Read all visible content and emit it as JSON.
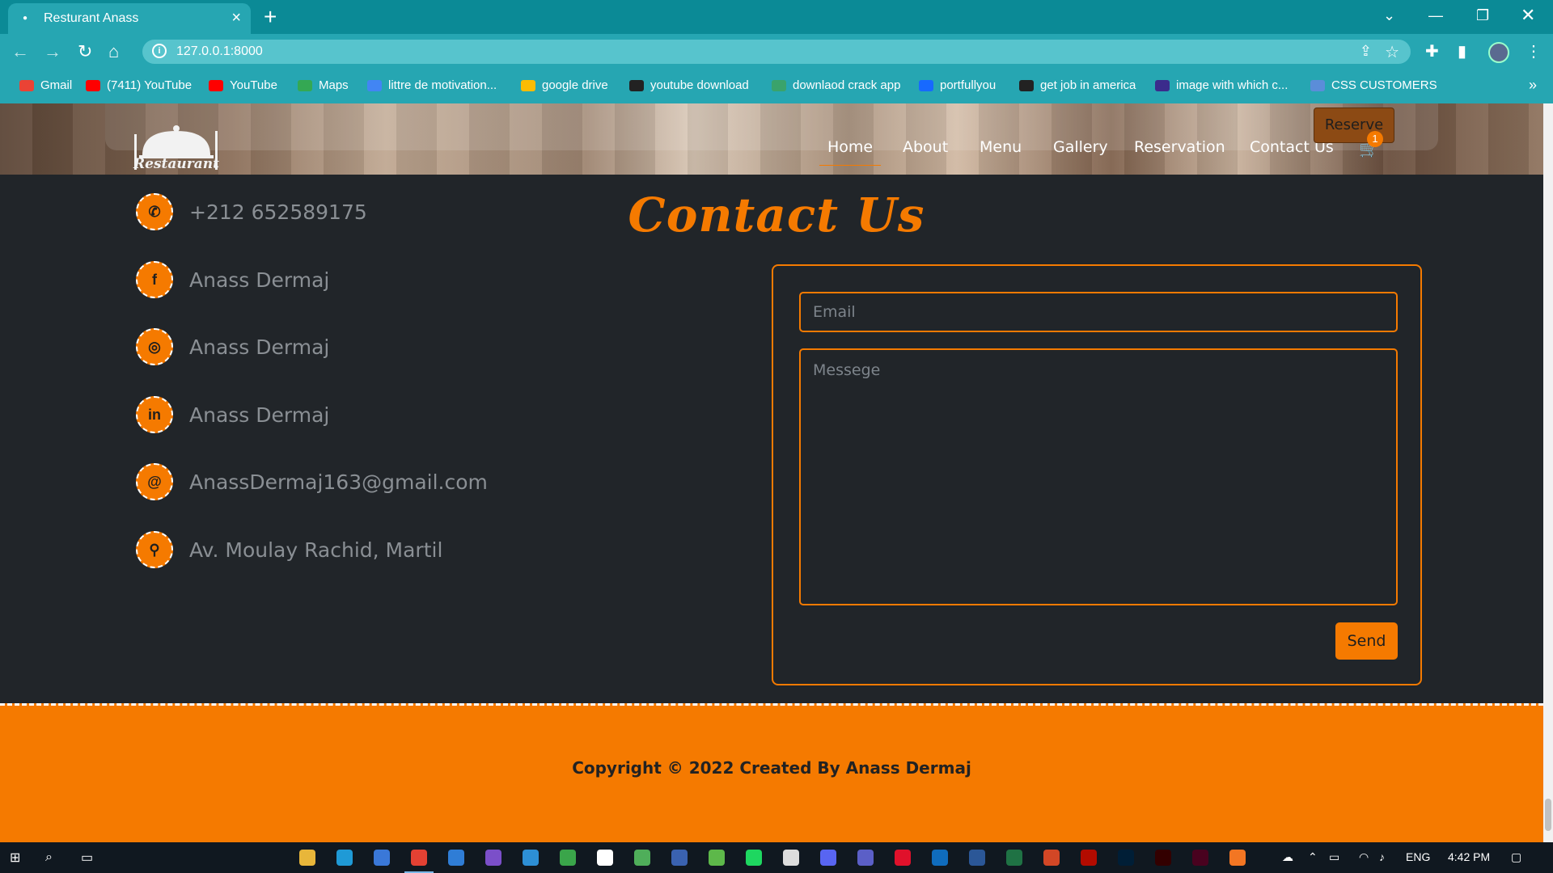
{
  "browser": {
    "tab_title": "Resturant Anass",
    "url": "127.0.0.1:8000",
    "bookmarks": [
      {
        "label": "Gmail",
        "icon": "gmail-icon",
        "color": "#ea4335"
      },
      {
        "label": "(7411) YouTube",
        "icon": "youtube-icon",
        "color": "#ff0000"
      },
      {
        "label": "YouTube",
        "icon": "youtube-icon",
        "color": "#ff0000"
      },
      {
        "label": "Maps",
        "icon": "maps-icon",
        "color": "#34a853"
      },
      {
        "label": "littre de motivation...",
        "icon": "docs-icon",
        "color": "#4285f4"
      },
      {
        "label": "google drive",
        "icon": "drive-icon",
        "color": "#fbbc04"
      },
      {
        "label": "youtube download",
        "icon": "globe-icon",
        "color": "#222222"
      },
      {
        "label": "downlaod crack app",
        "icon": "globe-icon",
        "color": "#3aa36b"
      },
      {
        "label": "portfullyou",
        "icon": "behance-icon",
        "color": "#1769ff"
      },
      {
        "label": "get job in america",
        "icon": "globe-icon",
        "color": "#222222"
      },
      {
        "label": "image with which c...",
        "icon": "globe-icon",
        "color": "#3b2b8c"
      },
      {
        "label": "CSS CUSTOMERS",
        "icon": "css-icon",
        "color": "#5b8dd9"
      }
    ]
  },
  "site": {
    "logo_text": "Restaurant",
    "nav": [
      "Home",
      "About",
      "Menu",
      "Gallery",
      "Reservation",
      "Contact Us"
    ],
    "reserve_label": "Reserve",
    "cart_count": "1",
    "title": "Contact Us",
    "contacts": [
      {
        "icon": "phone-icon",
        "glyph": "✆",
        "text": "+212 652589175"
      },
      {
        "icon": "facebook-icon",
        "glyph": "f",
        "text": "Anass Dermaj"
      },
      {
        "icon": "instagram-icon",
        "glyph": "◎",
        "text": "Anass Dermaj"
      },
      {
        "icon": "linkedin-icon",
        "glyph": "in",
        "text": "Anass Dermaj"
      },
      {
        "icon": "at-icon",
        "glyph": "@",
        "text": "AnassDermaj163@gmail.com"
      },
      {
        "icon": "location-icon",
        "glyph": "⚲",
        "text": "Av. Moulay Rachid, Martil"
      }
    ],
    "form": {
      "email_placeholder": "Email",
      "message_placeholder": "Messege",
      "send_label": "Send"
    },
    "footer": "Copyright © 2022 Created By Anass Dermaj"
  },
  "taskbar": {
    "language": "ENG",
    "time": "4:42 PM"
  },
  "colors": {
    "accent": "#f57a00",
    "page_bg": "#212529",
    "browser_chrome": "#26a6b2"
  }
}
